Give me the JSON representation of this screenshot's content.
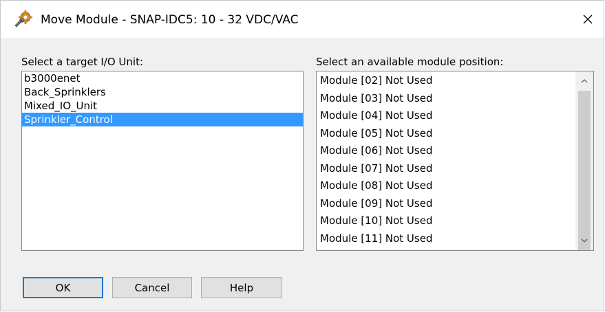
{
  "window": {
    "title": "Move Module - SNAP-IDC5: 10 - 32 VDC/VAC",
    "icon": "wrench-gear-icon",
    "close_icon": "close-icon"
  },
  "left_panel": {
    "label": "Select a target I/O Unit:",
    "items": [
      "b3000enet",
      "Back_Sprinklers",
      "Mixed_IO_Unit",
      "Sprinkler_Control"
    ],
    "selected_index": 3
  },
  "right_panel": {
    "label": "Select an available module position:",
    "items": [
      "Module [02] Not Used",
      "Module [03] Not Used",
      "Module [04] Not Used",
      "Module [05] Not Used",
      "Module [06] Not Used",
      "Module [07] Not Used",
      "Module [08] Not Used",
      "Module [09] Not Used",
      "Module [10] Not Used",
      "Module [11] Not Used"
    ]
  },
  "buttons": {
    "ok": "OK",
    "cancel": "Cancel",
    "help": "Help"
  },
  "colors": {
    "selection": "#3399ff",
    "default_button_border": "#0078d7",
    "dialog_background": "#f0f0f0"
  }
}
